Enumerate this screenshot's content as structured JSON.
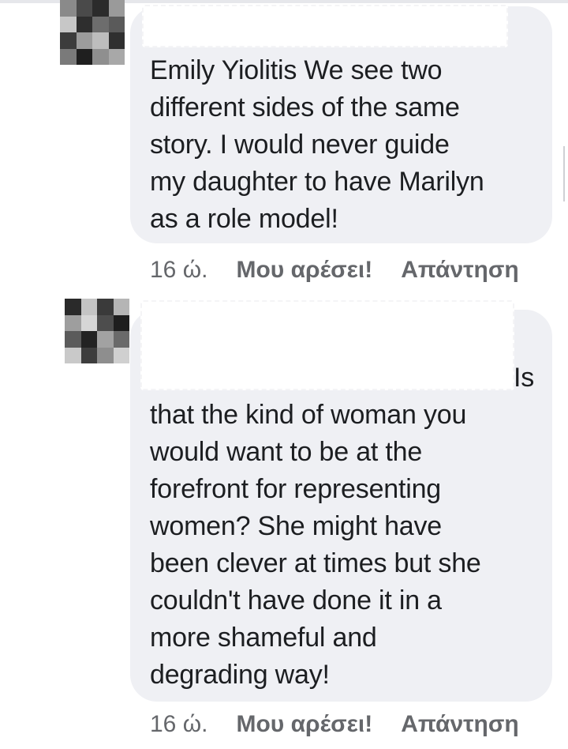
{
  "comments": [
    {
      "avatar": {
        "icon": "pixelated-avatar-icon",
        "pixels": [
          "#8a8a8a",
          "#4a4a4a",
          "#2b2b2b",
          "#9a9a9a",
          "#c7c7c7",
          "#2e2e2e",
          "#6d6d6d",
          "#5a5a5a",
          "#3c3c3c",
          "#9c9c9c",
          "#bdbdbd",
          "#2f2f2f",
          "#7a7a7a",
          "#1f1f1f",
          "#8f8f8f",
          "#a8a8a8"
        ]
      },
      "text": "Emily Yiolitis We see two\ndifferent sides of the same\nstory. I would never guide\nmy daughter to have Marilyn\nas a role model!",
      "time": "16 ώ.",
      "like_label": "Μου αρέσει!",
      "reply_label": "Απάντηση"
    },
    {
      "avatar": {
        "icon": "pixelated-avatar-icon",
        "pixels": [
          "#2a2a2a",
          "#c4c4c4",
          "#3a3a3a",
          "#b5b5b5",
          "#9e9e9e",
          "#d6d6d6",
          "#4d4d4d",
          "#1e1e1e",
          "#5b5b5b",
          "#222222",
          "#a2a2a2",
          "#6a6a6a",
          "#c9c9c9",
          "#3d3d3d",
          "#8e8e8e",
          "#d0d0d0"
        ]
      },
      "text_line1": "Is",
      "text": "that the kind of woman you\nwould want to be at the\nforefront for representing\nwomen? She might have\nbeen clever at times but she\ncouldn't have done it in a\nmore shameful and\ndegrading way!",
      "time": "16 ώ.",
      "like_label": "Μου αρέσει!",
      "reply_label": "Απάντηση"
    }
  ],
  "colors": {
    "bubble": "#eff0f4",
    "text": "#1c1e21",
    "meta": "#65676b"
  }
}
